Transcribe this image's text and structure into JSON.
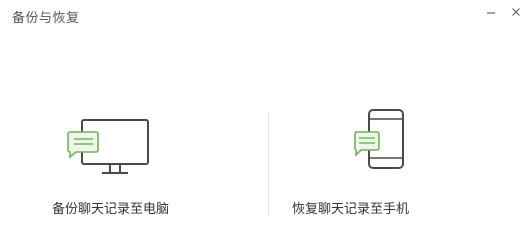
{
  "window": {
    "title": "备份与恢复"
  },
  "controls": {
    "minimize_icon": "minimize-icon",
    "close_icon": "close-icon"
  },
  "options": {
    "backup_to_pc": {
      "label": "备份聊天记录至电脑",
      "icon": "monitor-chat-icon"
    },
    "restore_to_phone": {
      "label": "恢复聊天记录至手机",
      "icon": "phone-chat-icon"
    }
  },
  "colors": {
    "accent_green": "#71b35a",
    "accent_fill": "#eef6ea",
    "icon_stroke": "#4a4a4a",
    "divider": "#e6e6e6"
  }
}
